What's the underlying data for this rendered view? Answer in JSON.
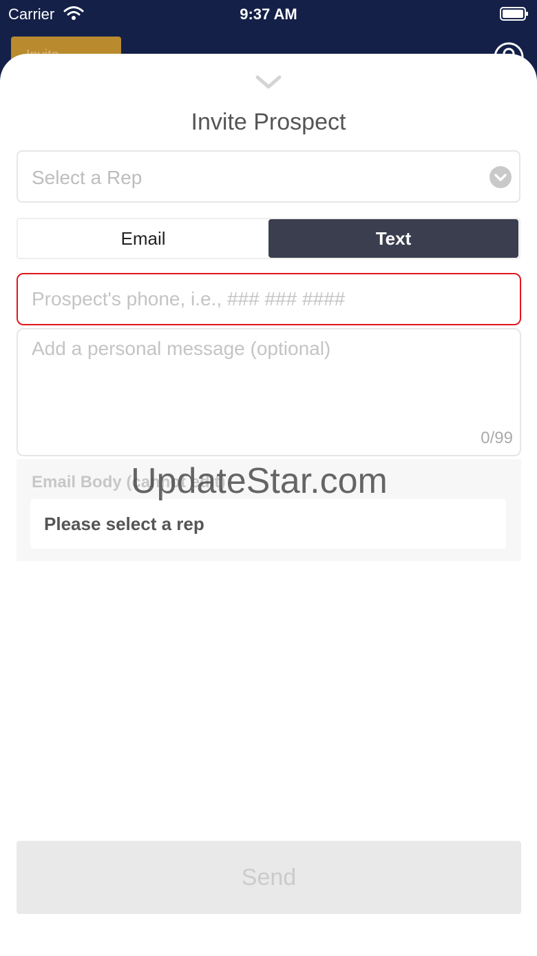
{
  "status_bar": {
    "carrier": "Carrier",
    "time": "9:37 AM"
  },
  "background_app": {
    "invite_button_label": "Invite"
  },
  "sheet": {
    "title": "Invite Prospect",
    "rep_select": {
      "placeholder": "Select a Rep"
    },
    "segment": {
      "email_label": "Email",
      "text_label": "Text",
      "selected": "Text"
    },
    "phone_input": {
      "value": "",
      "placeholder": "Prospect's phone, i.e., ### ### ####"
    },
    "message_input": {
      "value": "",
      "placeholder": "Add a personal message (optional)",
      "char_count": "0/99"
    },
    "email_body": {
      "label": "Email Body (cannot edit)",
      "content": "Please select a rep"
    },
    "watermark": "UpdateStar.com",
    "send_label": "Send"
  },
  "colors": {
    "nav_background": "#142048",
    "accent_gold": "#b98a2e",
    "segment_selected": "#3b3e4f",
    "error_border": "#e0161b"
  }
}
